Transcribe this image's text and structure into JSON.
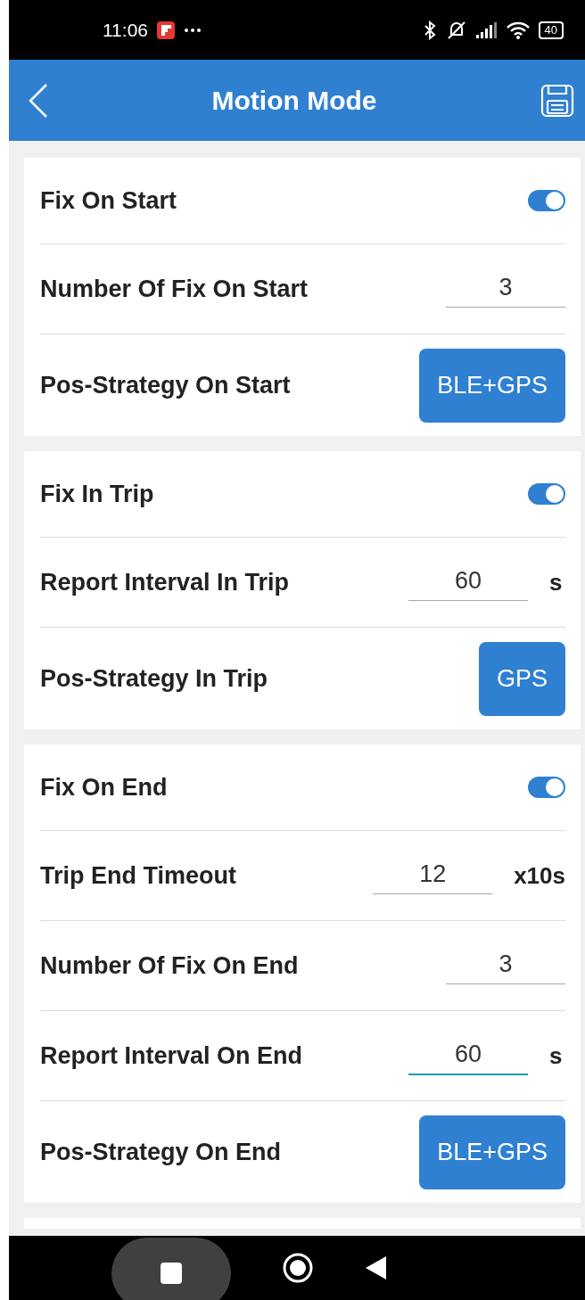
{
  "status_bar": {
    "time": "11:06",
    "battery": "40"
  },
  "header": {
    "title": "Motion Mode"
  },
  "sections": [
    {
      "rows": [
        {
          "kind": "toggle",
          "label": "Fix On Start",
          "on": true
        },
        {
          "kind": "input",
          "label": "Number Of Fix On Start",
          "value": "3",
          "focused": false
        },
        {
          "kind": "button",
          "label": "Pos-Strategy On Start",
          "button": "BLE+GPS"
        }
      ]
    },
    {
      "rows": [
        {
          "kind": "toggle",
          "label": "Fix In Trip",
          "on": true
        },
        {
          "kind": "input",
          "label": "Report Interval In Trip",
          "value": "60",
          "unit": "s",
          "focused": false
        },
        {
          "kind": "button",
          "label": "Pos-Strategy In Trip",
          "button": "GPS"
        }
      ]
    },
    {
      "rows": [
        {
          "kind": "toggle",
          "label": "Fix On End",
          "on": true
        },
        {
          "kind": "input",
          "label": "Trip End Timeout",
          "value": "12",
          "unit": "x10s",
          "focused": false
        },
        {
          "kind": "input",
          "label": "Number Of Fix On End",
          "value": "3",
          "focused": false
        },
        {
          "kind": "input",
          "label": "Report Interval On End",
          "value": "60",
          "unit": "s",
          "focused": true
        },
        {
          "kind": "button",
          "label": "Pos-Strategy On End",
          "button": "BLE+GPS"
        }
      ]
    }
  ]
}
